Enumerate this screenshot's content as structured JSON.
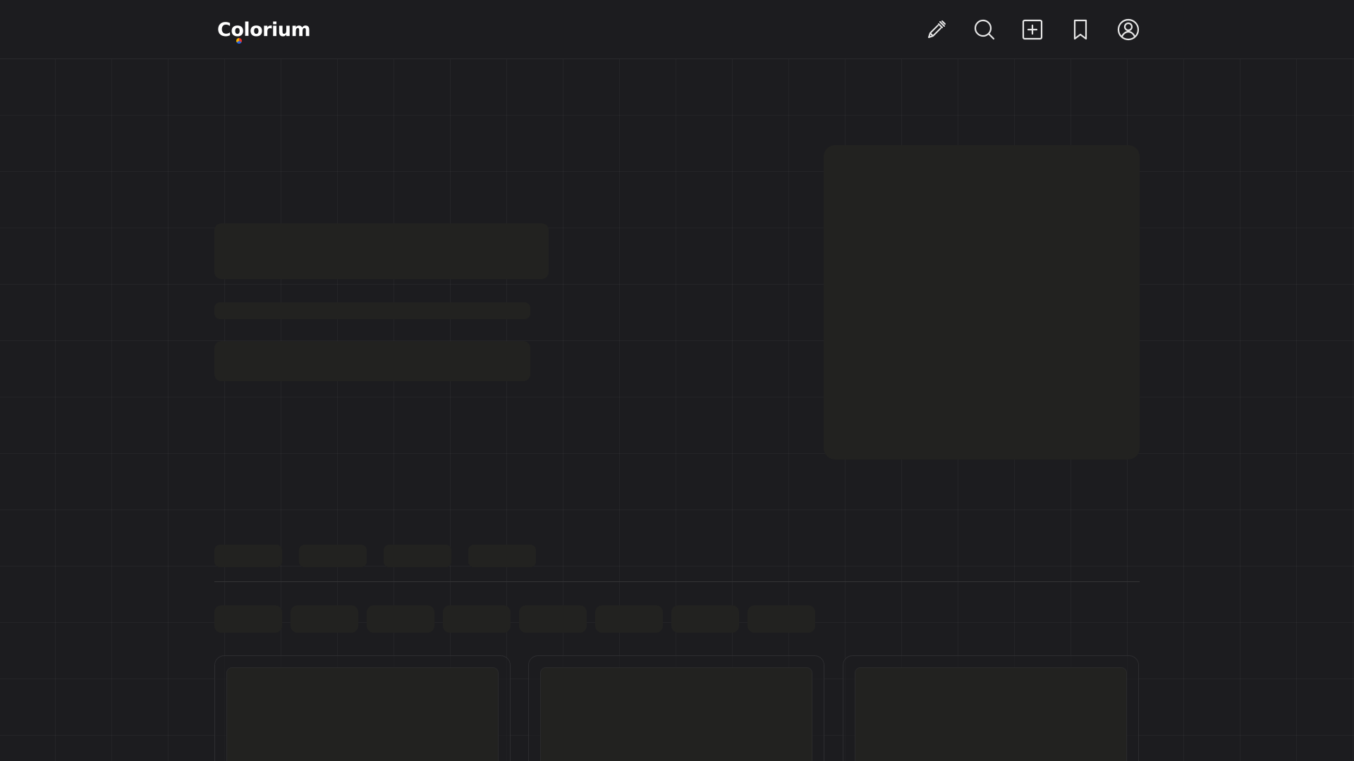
{
  "app": {
    "logo_text": "Colorium",
    "logo_dot_colors": [
      "#e8352e",
      "#2a66e0",
      "#f4b400"
    ]
  },
  "header": {
    "icons": [
      {
        "name": "color-picker-icon",
        "label": ""
      },
      {
        "name": "search-icon",
        "label": ""
      },
      {
        "name": "add-square-icon",
        "label": ""
      },
      {
        "name": "bookmark-icon",
        "label": ""
      },
      {
        "name": "user-account-icon",
        "label": ""
      }
    ]
  },
  "state": "loading-skeleton",
  "colors": {
    "background": "#1c1c1f",
    "skeleton": "#222220",
    "border": "#2d2d30",
    "text": "#ffffff"
  }
}
